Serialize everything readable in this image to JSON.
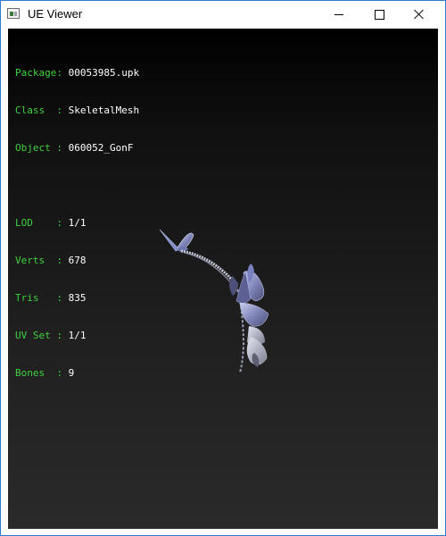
{
  "window": {
    "title": "UE Viewer"
  },
  "info": {
    "rows_top": [
      {
        "key": "Package: ",
        "value": "00053985.upk"
      },
      {
        "key": "Class  : ",
        "value": "SkeletalMesh"
      },
      {
        "key": "Object : ",
        "value": "060052_GonF"
      }
    ],
    "rows_bottom": [
      {
        "key": "LOD    : ",
        "value": "1/1"
      },
      {
        "key": "Verts  : ",
        "value": "678"
      },
      {
        "key": "Tris   : ",
        "value": "835"
      },
      {
        "key": "UV Set : ",
        "value": "1/1"
      },
      {
        "key": "Bones  : ",
        "value": "9"
      }
    ]
  },
  "colors": {
    "info_key": "#3fd23f",
    "info_value": "#ffffff",
    "window_border": "#2e7bd6"
  },
  "icons": {
    "app": "app-window-icon",
    "minimize": "minimize-icon",
    "maximize": "maximize-icon",
    "close": "close-icon"
  }
}
